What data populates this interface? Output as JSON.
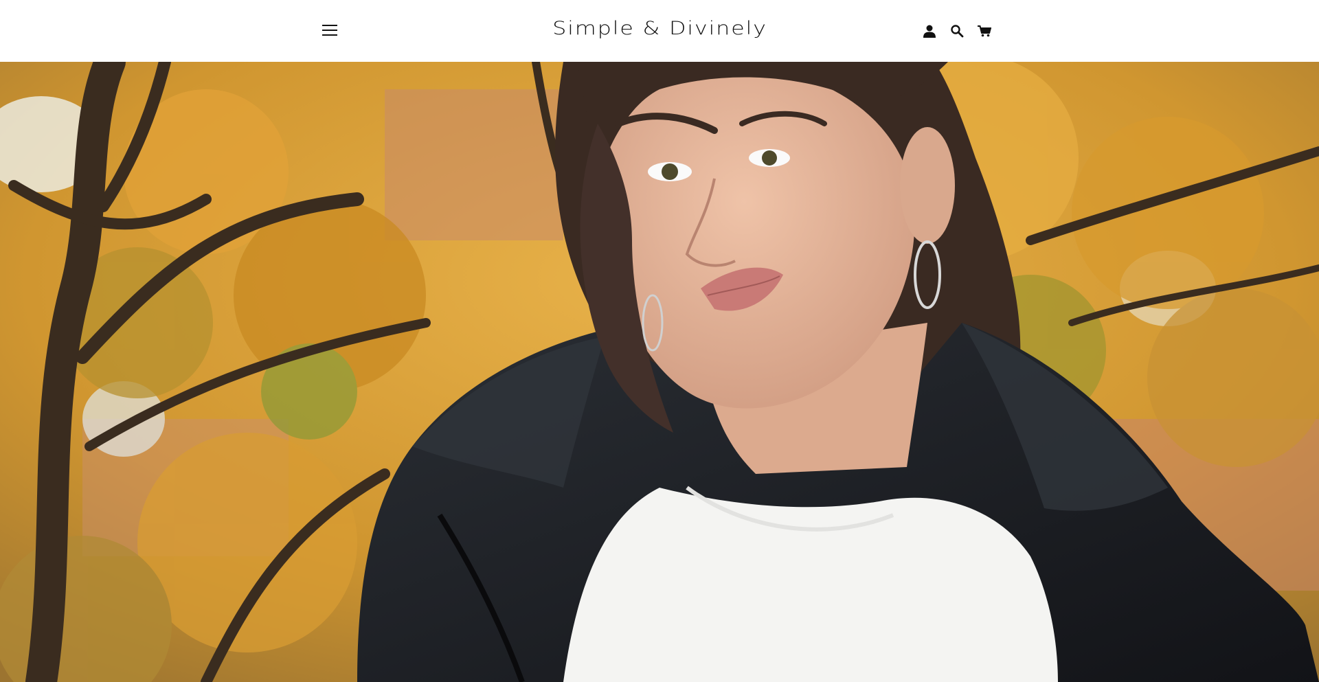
{
  "header": {
    "logo_text": "Simple & Divinely",
    "menu_icon": "hamburger-menu-icon",
    "icons": [
      "account-icon",
      "search-icon",
      "cart-icon"
    ]
  },
  "hero": {
    "description": "woman in black puffer jacket and white t-shirt in front of autumn tree",
    "colors": {
      "foliage": "#d59a2e",
      "jacket": "#1c1e22",
      "shirt": "#f4f4f2",
      "skin": "#e6b79c",
      "hair": "#3a2a22"
    }
  }
}
